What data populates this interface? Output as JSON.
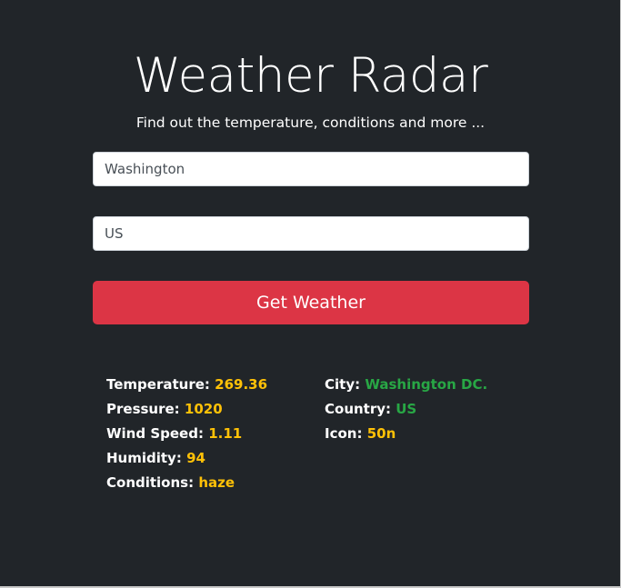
{
  "header": {
    "title": "Weather Radar",
    "subtitle": "Find out the temperature, conditions and more ..."
  },
  "form": {
    "city_value": "Washington",
    "country_value": "US",
    "submit_label": "Get Weather"
  },
  "results": {
    "temperature": {
      "label": "Temperature:",
      "value": "269.36"
    },
    "pressure": {
      "label": "Pressure:",
      "value": "1020"
    },
    "wind_speed": {
      "label": "Wind Speed:",
      "value": "1.11"
    },
    "humidity": {
      "label": "Humidity:",
      "value": "94"
    },
    "conditions": {
      "label": "Conditions:",
      "value": "haze"
    },
    "city": {
      "label": "City:",
      "value": "Washington DC."
    },
    "country": {
      "label": "Country:",
      "value": "US"
    },
    "icon": {
      "label": "Icon:",
      "value": "50n"
    }
  },
  "colors": {
    "background": "#212529",
    "button": "#dc3545",
    "value_warning": "#ffc107",
    "value_success": "#28a745"
  }
}
